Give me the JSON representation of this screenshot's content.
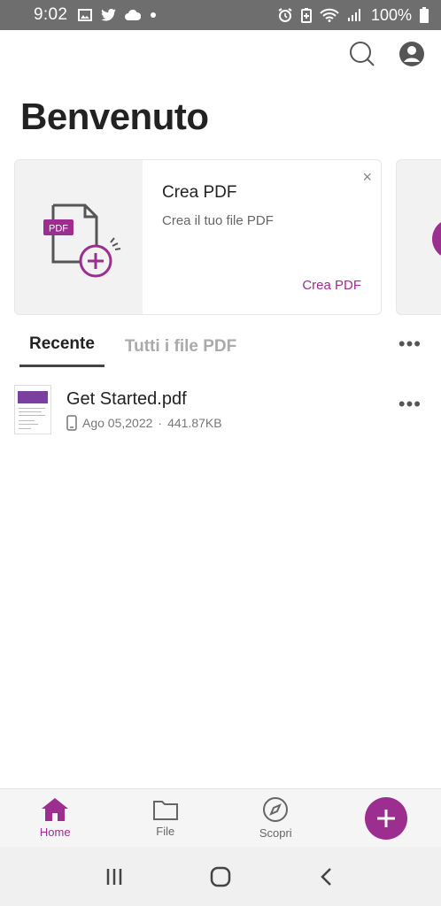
{
  "status_bar": {
    "time": "9:02",
    "left_icons": [
      "image-icon",
      "twitter-icon",
      "cloud-icon",
      "dot-icon"
    ],
    "right_icons": [
      "alarm-icon",
      "battery-saver-icon",
      "wifi-icon",
      "signal-icon",
      "battery-icon"
    ],
    "battery": "100%"
  },
  "header": {
    "title": "Benvenuto",
    "actions": [
      "search-icon",
      "account-icon"
    ]
  },
  "promo_card": {
    "title": "Crea PDF",
    "description": "Crea il tuo file PDF",
    "cta": "Crea PDF",
    "badge": "PDF",
    "close": "×"
  },
  "tabs": [
    {
      "label": "Recente",
      "active": true
    },
    {
      "label": "Tutti i file PDF",
      "active": false
    }
  ],
  "more_glyph": "•••",
  "files": [
    {
      "name": "Get Started.pdf",
      "date": "Ago 05,2022",
      "separator": "·",
      "size": "441.87KB",
      "location_icon": "phone-icon"
    }
  ],
  "bottom_nav": {
    "items": [
      {
        "label": "Home",
        "icon": "home-icon",
        "active": true
      },
      {
        "label": "File",
        "icon": "folder-icon",
        "active": false
      },
      {
        "label": "Scopri",
        "icon": "compass-icon",
        "active": false
      }
    ],
    "fab_icon": "plus-icon"
  },
  "system_nav": [
    "recents-icon",
    "home-circle-icon",
    "back-icon"
  ],
  "colors": {
    "accent": "#9b2e8e",
    "status_bar": "#6e6e6e",
    "nav_background": "#f5f5f5"
  }
}
